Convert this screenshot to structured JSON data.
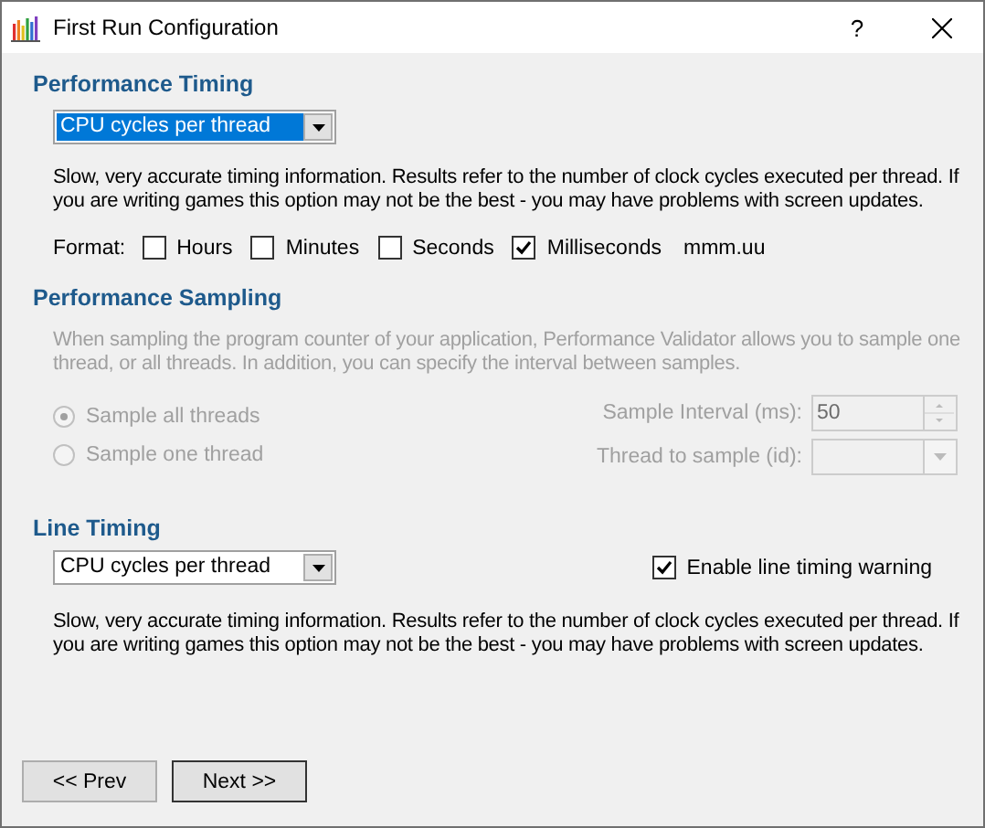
{
  "window": {
    "title": "First Run Configuration",
    "help": "?"
  },
  "performance_timing": {
    "heading": "Performance Timing",
    "dropdown": {
      "value": "CPU cycles per thread",
      "highlighted": true
    },
    "description": "Slow, very accurate timing information. Results refer to the number of clock cycles executed per thread. If you are writing games this option may not be the best - you may have problems with screen updates.",
    "format": {
      "label": "Format:",
      "options": [
        {
          "label": "Hours",
          "checked": false
        },
        {
          "label": "Minutes",
          "checked": false
        },
        {
          "label": "Seconds",
          "checked": false
        },
        {
          "label": "Milliseconds",
          "checked": true
        }
      ],
      "example": "mmm.uu"
    }
  },
  "performance_sampling": {
    "heading": "Performance Sampling",
    "disabled": true,
    "description": "When sampling the program counter of your application, Performance Validator allows you to sample one thread, or all threads. In addition, you can specify the interval between samples.",
    "modes": [
      {
        "label": "Sample all threads",
        "selected": true
      },
      {
        "label": "Sample one thread",
        "selected": false
      }
    ],
    "sample_interval": {
      "label": "Sample Interval (ms):",
      "value": "50"
    },
    "thread_to_sample": {
      "label": "Thread to sample (id):"
    }
  },
  "line_timing": {
    "heading": "Line Timing",
    "dropdown": {
      "value": "CPU cycles per thread",
      "highlighted": false
    },
    "warning_checkbox": {
      "label": "Enable line timing warning",
      "checked": true
    },
    "description": "Slow, very accurate timing information. Results refer to the number of clock cycles executed per thread. If you are writing games this option may not be the best - you may have problems with screen updates."
  },
  "buttons": [
    "<< Prev",
    "Next >>"
  ]
}
